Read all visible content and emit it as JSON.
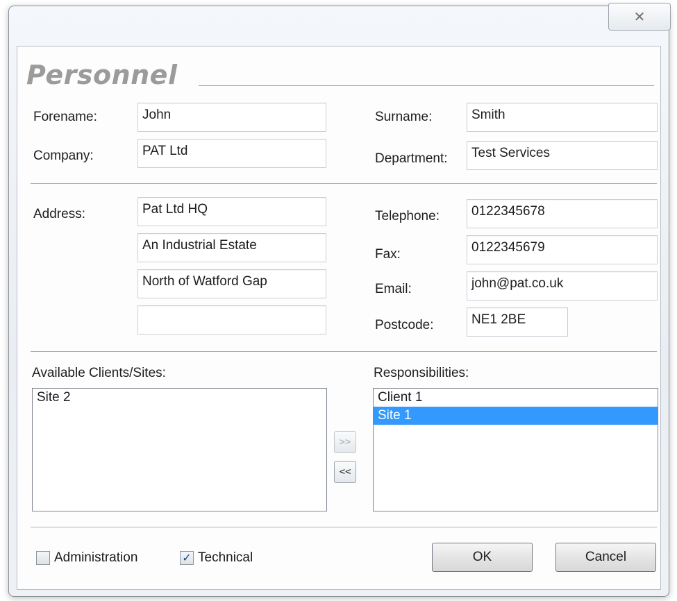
{
  "window": {
    "close_glyph": "✕"
  },
  "section_title": "Personnel",
  "fields": {
    "forename": {
      "label": "Forename:",
      "value": "John"
    },
    "surname": {
      "label": "Surname:",
      "value": "Smith"
    },
    "company": {
      "label": "Company:",
      "value": "PAT Ltd"
    },
    "department": {
      "label": "Department:",
      "value": "Test Services"
    },
    "address": {
      "label": "Address:",
      "lines": [
        "Pat Ltd HQ",
        "An Industrial Estate",
        "North of Watford Gap",
        ""
      ]
    },
    "telephone": {
      "label": "Telephone:",
      "value": "0122345678"
    },
    "fax": {
      "label": "Fax:",
      "value": "0122345679"
    },
    "email": {
      "label": "Email:",
      "value": "john@pat.co.uk"
    },
    "postcode": {
      "label": "Postcode:",
      "value": "NE1 2BE"
    }
  },
  "available": {
    "label": "Available Clients/Sites:",
    "items": [
      "Site 2"
    ]
  },
  "responsibilities": {
    "label": "Responsibilities:",
    "items": [
      "Client 1",
      "Site 1"
    ],
    "selected": "Site 1"
  },
  "transfer": {
    "add_label": ">>",
    "remove_label": "<<"
  },
  "roles": {
    "administration": {
      "label": "Administration",
      "checked": false
    },
    "technical": {
      "label": "Technical",
      "checked": true,
      "check_glyph": "✓"
    }
  },
  "buttons": {
    "ok": "OK",
    "cancel": "Cancel"
  },
  "colors": {
    "selection": "#3399ff",
    "title_gray": "#9b9b9b"
  }
}
